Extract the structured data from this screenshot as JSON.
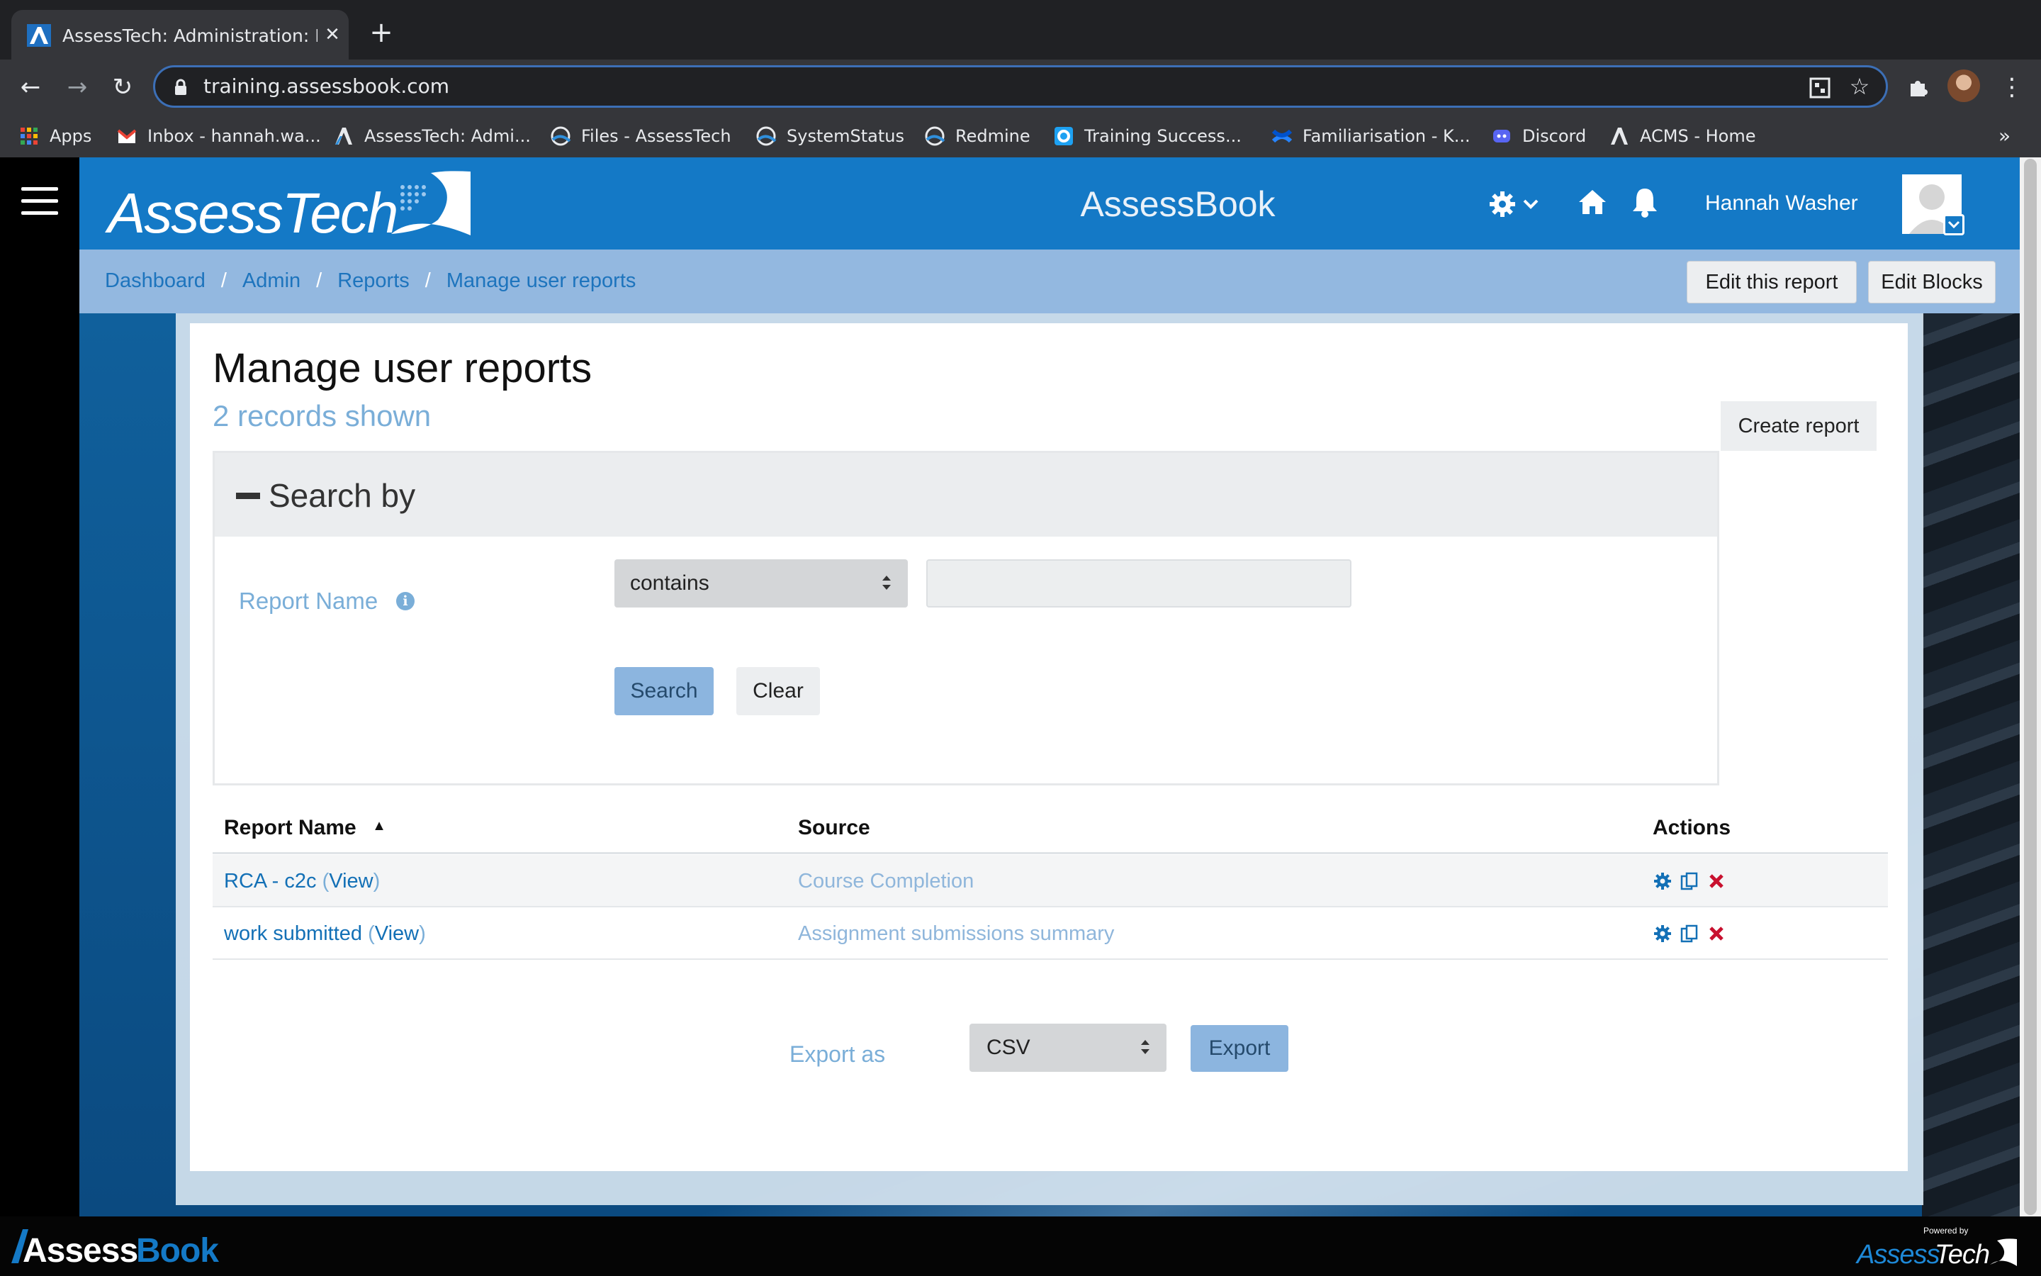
{
  "browser": {
    "tab_title": "AssessTech: Administration: Re",
    "url": "training.assessbook.com",
    "bookmarks": [
      {
        "label": "Apps",
        "icon": "apps-grid-icon"
      },
      {
        "label": "Inbox - hannah.wa...",
        "icon": "gmail-icon"
      },
      {
        "label": "AssessTech: Admi...",
        "icon": "assesstech-icon"
      },
      {
        "label": "Files - AssessTech",
        "icon": "assessbook-icon"
      },
      {
        "label": "SystemStatus",
        "icon": "assessbook-icon"
      },
      {
        "label": "Redmine",
        "icon": "assessbook-icon"
      },
      {
        "label": "Training Success...",
        "icon": "training-icon"
      },
      {
        "label": "Familiarisation - K...",
        "icon": "confluence-icon"
      },
      {
        "label": "Discord",
        "icon": "discord-icon"
      },
      {
        "label": "ACMS - Home",
        "icon": "assesstech-icon"
      }
    ],
    "more": "»"
  },
  "header": {
    "brand": "AssessTech",
    "app_name": "AssessBook",
    "user_name": "Hannah Washer"
  },
  "breadcrumb": [
    "Dashboard",
    "Admin",
    "Reports",
    "Manage user reports"
  ],
  "header_buttons": {
    "edit_report": "Edit this report",
    "edit_blocks": "Edit Blocks"
  },
  "main": {
    "title": "Manage user reports",
    "records": "2 records shown",
    "create_report": "Create report"
  },
  "search": {
    "heading": "Search by",
    "field_label": "Report Name",
    "operator": "contains",
    "value": "",
    "search_label": "Search",
    "clear_label": "Clear"
  },
  "table": {
    "headers": {
      "name": "Report Name",
      "source": "Source",
      "actions": "Actions"
    },
    "sort_indicator": "▲",
    "rows": [
      {
        "name": "RCA - c2c",
        "view": "View",
        "source": "Course Completion"
      },
      {
        "name": "work submitted",
        "view": "View",
        "source": "Assignment submissions summary"
      }
    ]
  },
  "export": {
    "label": "Export as",
    "format": "CSV",
    "button": "Export"
  },
  "footer": {
    "brand": "AssessBook",
    "powered_by": "Powered by",
    "powered_brand": "AssessTech"
  },
  "colors": {
    "header_blue": "#1479c6",
    "subheader_blue": "#93b8e0",
    "link_blue": "#1370b6",
    "muted_blue": "#7aaed8",
    "delete_red": "#c8102e"
  }
}
